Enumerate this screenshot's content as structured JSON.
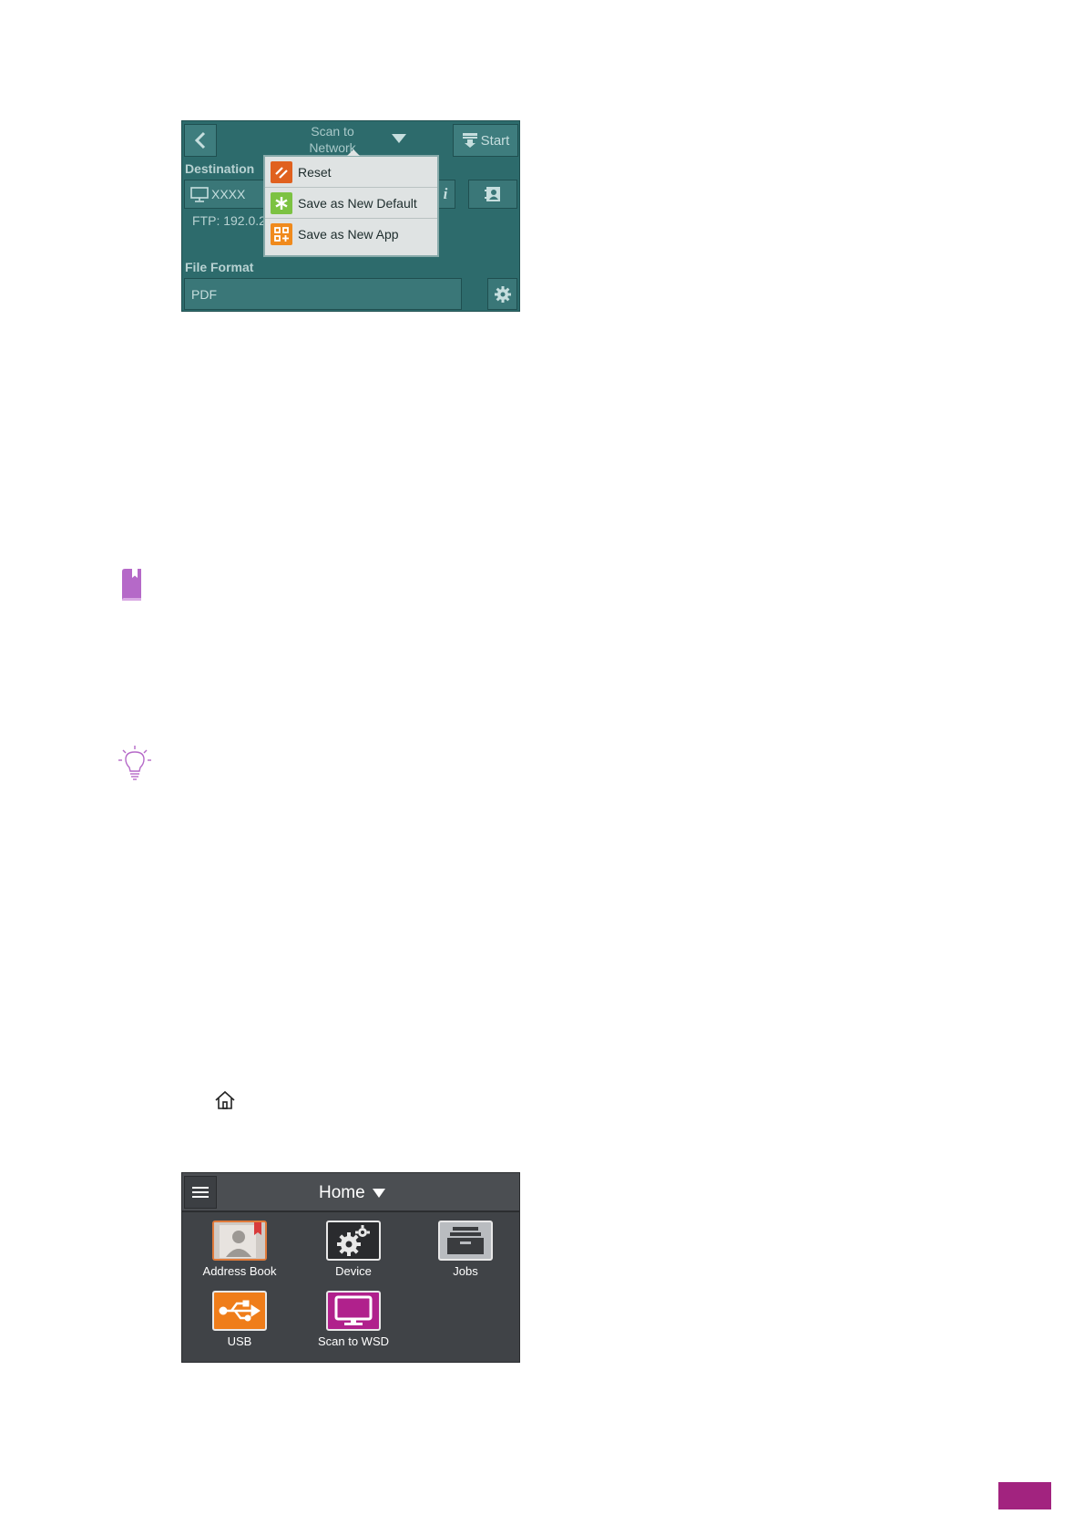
{
  "scan_panel": {
    "title": "Scan to Network",
    "start_label": "Start",
    "destination_label": "Destination",
    "destination_value": "XXXX",
    "ftp_text": "FTP: 192.0.2",
    "info_label": "i",
    "file_format_label": "File Format",
    "file_format_value": "PDF",
    "menu": {
      "items": [
        {
          "label": "Reset",
          "icon": "reset-icon",
          "color": "#e0611f"
        },
        {
          "label": "Save as New Default",
          "icon": "save-default-icon",
          "color": "#7cc242"
        },
        {
          "label": "Save as New App",
          "icon": "save-app-icon",
          "color": "#f08a1c"
        }
      ]
    }
  },
  "home_panel": {
    "title": "Home",
    "apps": [
      {
        "label": "Address Book",
        "icon": "address-book-icon"
      },
      {
        "label": "Device",
        "icon": "device-gear-icon"
      },
      {
        "label": "Jobs",
        "icon": "jobs-tray-icon"
      },
      {
        "label": "USB",
        "icon": "usb-icon",
        "color": "#ef7d1a"
      },
      {
        "label": "Scan to WSD",
        "icon": "monitor-icon",
        "color": "#b0218c"
      }
    ]
  },
  "colors": {
    "accent": "#a2237f",
    "note_icon": "#b569c8",
    "scan_panel_bg": "#2d6b6c",
    "home_panel_bg": "#404347"
  }
}
